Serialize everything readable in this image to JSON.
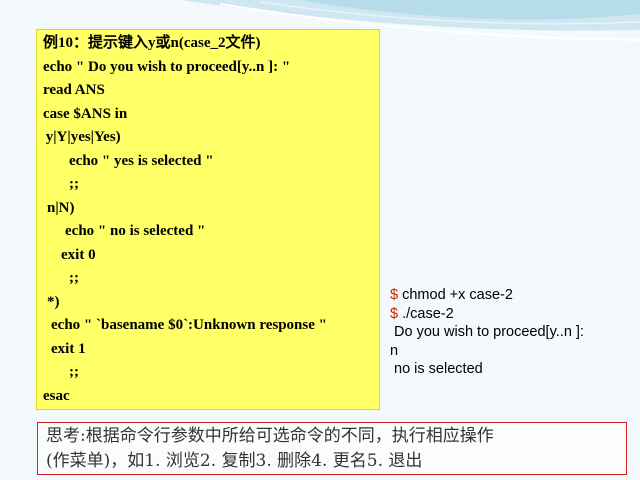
{
  "code_box": {
    "lines": [
      "例10：提示键入y或n(case_2文件)",
      "echo \" Do you wish to proceed[y..n ]: \"",
      "read ANS",
      "case $ANS in",
      " y|Y|yes|Yes)",
      "echo \" yes is selected \"",
      ";;",
      "n|N)",
      "echo \" no is selected \"",
      "exit 0",
      ";;",
      "*)",
      "echo \" `basename $0`:Unknown response \"",
      "exit 1",
      ";;",
      "esac"
    ]
  },
  "terminal": {
    "line1_prompt": "$",
    "line1_cmd": " chmod +x case-2",
    "line2_prompt": "$",
    "line2_cmd": " ./case-2",
    "line3": " Do you wish to proceed[y..n ]:",
    "line4": "n",
    "line5": " no is selected"
  },
  "think_box": {
    "line1": "思考:根据命令行参数中所给可选命令的不同，执行相应操作",
    "line2": "(作菜单)，如1. 浏览2. 复制3. 删除4. 更名5. 退出"
  }
}
